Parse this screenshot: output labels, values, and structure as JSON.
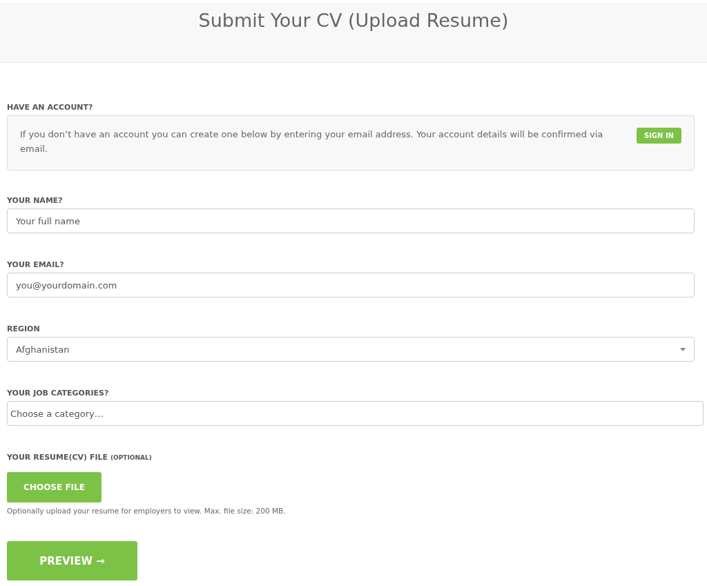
{
  "header": {
    "title": "Submit Your CV (Upload Resume)"
  },
  "account": {
    "label": "HAVE AN ACCOUNT?",
    "message": "If you don’t have an account you can create one below by entering your email address. Your account details will be confirmed via email.",
    "button": "SIGN IN"
  },
  "fields": [
    {
      "kind": "text",
      "label": "YOUR NAME?",
      "placeholder": "Your full name"
    },
    {
      "kind": "text",
      "label": "YOUR EMAIL?",
      "placeholder": "you@yourdomain.com"
    },
    {
      "kind": "select",
      "label": "REGION",
      "value": "Afghanistan"
    },
    {
      "kind": "multiselect",
      "label": "YOUR JOB CATEGORIES?",
      "placeholder": "Choose a category…"
    }
  ],
  "resume": {
    "label": "YOUR RESUME(CV) FILE",
    "note": "(OPTIONAL)",
    "button": "CHOOSE FILE",
    "help": "Optionally upload your resume for employers to view. Max. file size: 200 MB."
  },
  "submit": {
    "label": "PREVIEW →"
  }
}
